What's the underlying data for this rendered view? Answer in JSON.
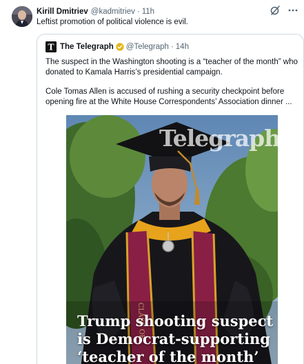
{
  "tweet": {
    "author_name": "Kirill Dmitriev",
    "author_handle": "@kadmitriev",
    "separator": "·",
    "time": "11h",
    "text": "Leftist promotion of political violence is evil."
  },
  "toolbar": {
    "icons": [
      "grok-icon",
      "more-icon"
    ]
  },
  "quoted_tweet": {
    "author_name": "The Telegraph",
    "author_handle": "@Telegraph",
    "separator": "·",
    "time": "14h",
    "verified_badge_color": "#e2b719",
    "paragraph_1": "The suspect in the Washington shooting is a “teacher of the month” who donated to Kamala Harris’s presidential campaign.",
    "paragraph_2": "Cole Tomas Allen is accused of rushing a security checkpoint before opening fire at the White House Correspondents’ Association dinner ...",
    "media": {
      "watermark": "Telegraph",
      "headline_line_1": "Trump shooting suspect",
      "headline_line_2": "is Democrat-supporting",
      "headline_line_3": "‘teacher of the month’",
      "stole_text": "CLASS OF"
    }
  },
  "colors": {
    "text_primary": "#0f1419",
    "text_secondary": "#536471",
    "border": "#cfd9de",
    "gown": "#17171b",
    "stole": "#8a1f45",
    "stole_trim": "#d8a22a",
    "hood_gold": "#e7a31c"
  }
}
